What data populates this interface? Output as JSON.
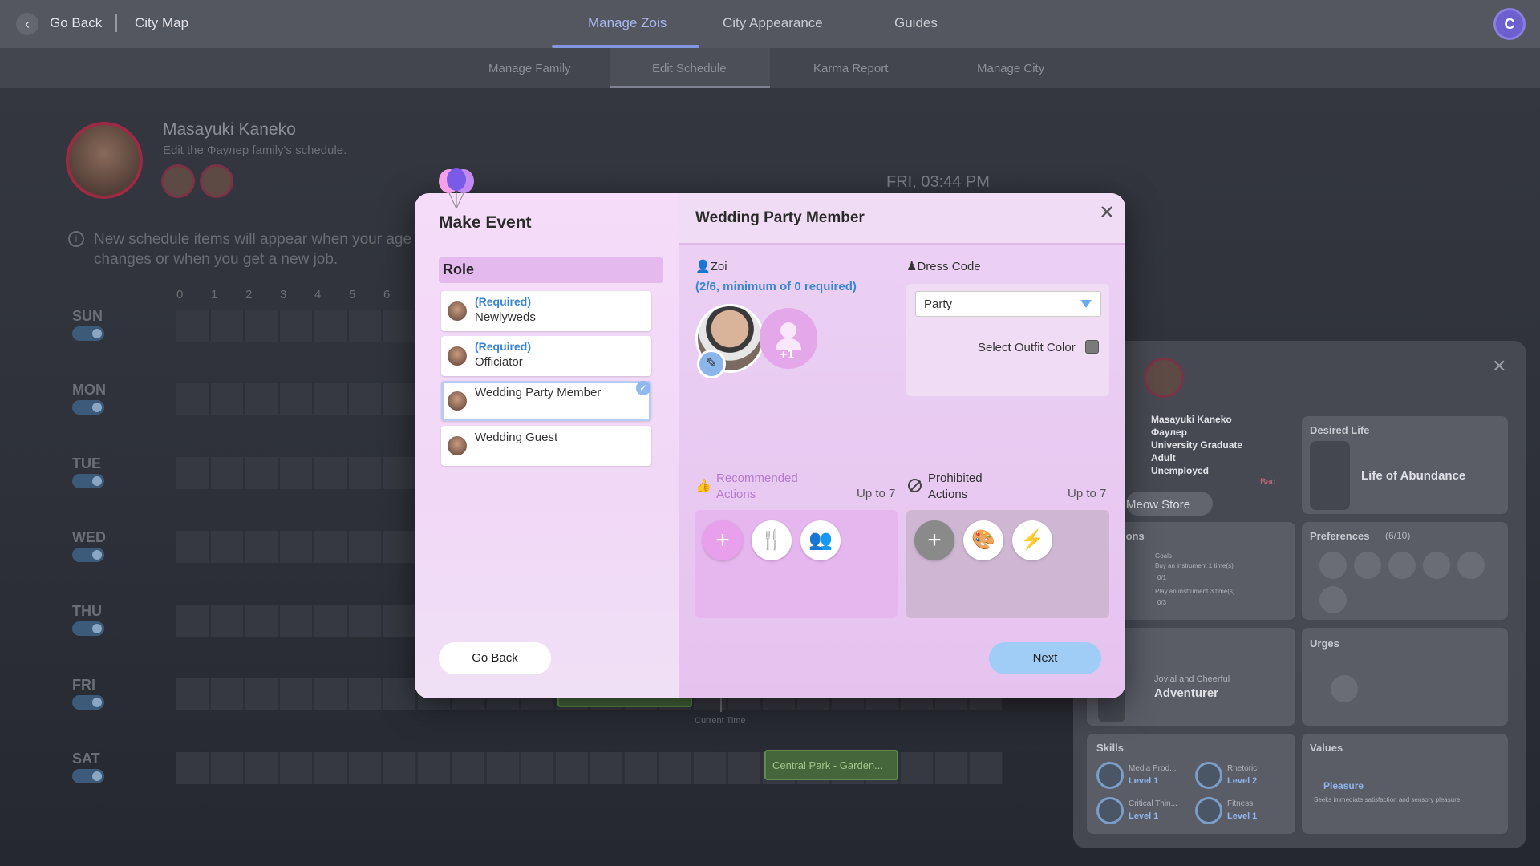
{
  "topbar": {
    "back_label": "Go Back",
    "city_map_label": "City Map",
    "tabs": [
      {
        "label": "Manage Zois",
        "active": true
      },
      {
        "label": "City Appearance",
        "active": false
      },
      {
        "label": "Guides",
        "active": false
      }
    ],
    "avatar_letter": "C"
  },
  "subbar": {
    "tabs": [
      {
        "label": "Manage Family"
      },
      {
        "label": "Edit Schedule"
      },
      {
        "label": "Karma Report"
      },
      {
        "label": "Manage City"
      }
    ]
  },
  "background": {
    "profile_name": "Masayuki Kaneko",
    "profile_sub": "Edit the Фаулер family's schedule.",
    "time": "FRI, 03:44 PM",
    "info": "New schedule items will appear when your age changes or when you get a new job.",
    "hours": [
      "0",
      "1",
      "2",
      "3",
      "4",
      "5",
      "6"
    ],
    "days": [
      "SUN",
      "MON",
      "TUE",
      "WED",
      "THU",
      "FRI",
      "SAT"
    ],
    "event_label": "Central Park - Garden...",
    "current_time_label": "Current Time"
  },
  "side_panel": {
    "name_lines": [
      "Masayuki Kaneko",
      "Фаулер",
      "University Graduate",
      "Adult",
      "Unemployed"
    ],
    "bad_label": "Bad",
    "desired_life_title": "Desired Life",
    "desired_life_value": "Life of Abundance",
    "store_button": "Meow Store",
    "ambitions_title": "ions",
    "goals_label": "Goals",
    "goal1": "Buy an instrument 1 time(s)",
    "goal1_progress": "0/1",
    "goal2": "Play an instrument 3 time(s)",
    "goal2_progress": "0/3",
    "preferences_title": "Preferences",
    "preferences_count": "(6/10)",
    "urges_title": "Urges",
    "trait_sub": "Jovial and Cheerful",
    "trait_main": "Adventurer",
    "skills_title": "Skills",
    "skills": [
      {
        "name": "Media Prod...",
        "level": "Level 1"
      },
      {
        "name": "Rhetoric",
        "level": "Level 2"
      },
      {
        "name": "Critical Thin...",
        "level": "Level 1"
      },
      {
        "name": "Fitness",
        "level": "Level 1"
      }
    ],
    "values_title": "Values",
    "value_name": "Pleasure",
    "value_desc": "Seeks immediate satisfaction and sensory pleasure."
  },
  "modal": {
    "title": "Make Event",
    "role_header": "Role",
    "roles": [
      {
        "required": "(Required)",
        "name": "Newlyweds"
      },
      {
        "required": "(Required)",
        "name": "Officiator"
      },
      {
        "required": "",
        "name": "Wedding Party Member",
        "selected": true
      },
      {
        "required": "",
        "name": "Wedding Guest"
      }
    ],
    "back_button": "Go Back",
    "next_button": "Next",
    "right_title": "Wedding Party Member",
    "zoi_label": "Zoi",
    "zoi_count": "(2/6, minimum of 0 required)",
    "plus_label": "+1",
    "dress_code_label": "Dress Code",
    "dress_code_value": "Party",
    "outfit_color_label": "Select Outfit Color",
    "recommended_label_1": "Recommended",
    "recommended_label_2": "Actions",
    "prohibited_label_1": "Prohibited",
    "prohibited_label_2": "Actions",
    "up_to": "Up to 7"
  }
}
